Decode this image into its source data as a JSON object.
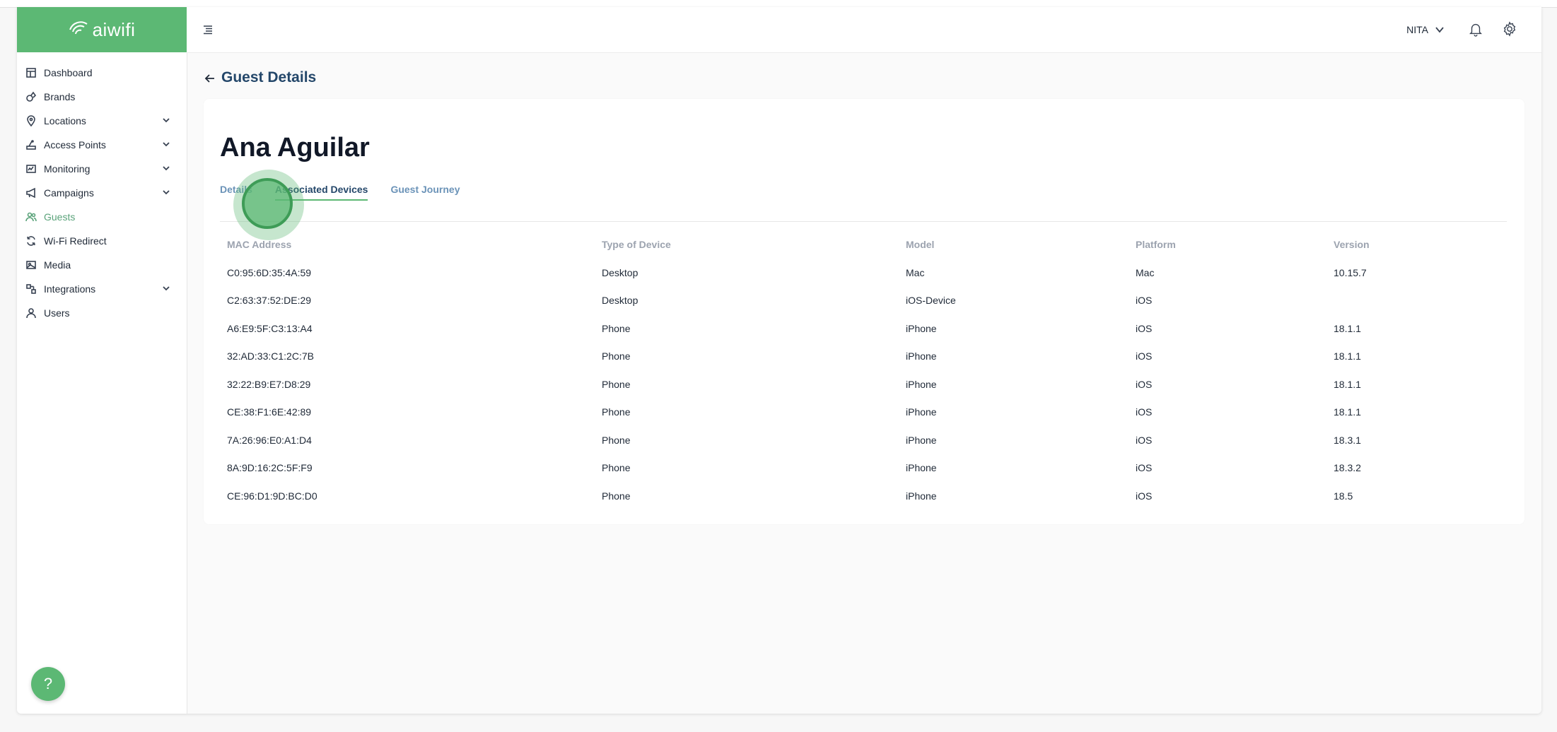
{
  "brand": {
    "logo_text": "aiwifi",
    "accent": "#5cb874"
  },
  "sidebar": {
    "items": [
      {
        "label": "Dashboard",
        "icon": "dashboard-icon",
        "expandable": false
      },
      {
        "label": "Brands",
        "icon": "brands-icon",
        "expandable": false
      },
      {
        "label": "Locations",
        "icon": "location-pin-icon",
        "expandable": true
      },
      {
        "label": "Access Points",
        "icon": "router-icon",
        "expandable": true
      },
      {
        "label": "Monitoring",
        "icon": "monitoring-icon",
        "expandable": true
      },
      {
        "label": "Campaigns",
        "icon": "megaphone-icon",
        "expandable": true
      },
      {
        "label": "Guests",
        "icon": "users-icon",
        "expandable": false,
        "active": true
      },
      {
        "label": "Wi-Fi Redirect",
        "icon": "refresh-icon",
        "expandable": false
      },
      {
        "label": "Media",
        "icon": "image-icon",
        "expandable": false
      },
      {
        "label": "Integrations",
        "icon": "integrations-icon",
        "expandable": true
      },
      {
        "label": "Users",
        "icon": "user-icon",
        "expandable": false
      }
    ],
    "help_label": "?"
  },
  "header": {
    "user_name": "NITA"
  },
  "page": {
    "title": "Guest Details",
    "guest_name": "Ana Aguilar",
    "tabs": [
      {
        "label": "Details",
        "active": false
      },
      {
        "label": "Associated Devices",
        "active": true
      },
      {
        "label": "Guest Journey",
        "active": false
      }
    ]
  },
  "devices": {
    "columns": [
      "MAC Address",
      "Type of Device",
      "Model",
      "Platform",
      "Version"
    ],
    "rows": [
      [
        "C0:95:6D:35:4A:59",
        "Desktop",
        "Mac",
        "Mac",
        "10.15.7"
      ],
      [
        "C2:63:37:52:DE:29",
        "Desktop",
        "iOS-Device",
        "iOS",
        ""
      ],
      [
        "A6:E9:5F:C3:13:A4",
        "Phone",
        "iPhone",
        "iOS",
        "18.1.1"
      ],
      [
        "32:AD:33:C1:2C:7B",
        "Phone",
        "iPhone",
        "iOS",
        "18.1.1"
      ],
      [
        "32:22:B9:E7:D8:29",
        "Phone",
        "iPhone",
        "iOS",
        "18.1.1"
      ],
      [
        "CE:38:F1:6E:42:89",
        "Phone",
        "iPhone",
        "iOS",
        "18.1.1"
      ],
      [
        "7A:26:96:E0:A1:D4",
        "Phone",
        "iPhone",
        "iOS",
        "18.3.1"
      ],
      [
        "8A:9D:16:2C:5F:F9",
        "Phone",
        "iPhone",
        "iOS",
        "18.3.2"
      ],
      [
        "CE:96:D1:9D:BC:D0",
        "Phone",
        "iPhone",
        "iOS",
        "18.5"
      ]
    ]
  }
}
